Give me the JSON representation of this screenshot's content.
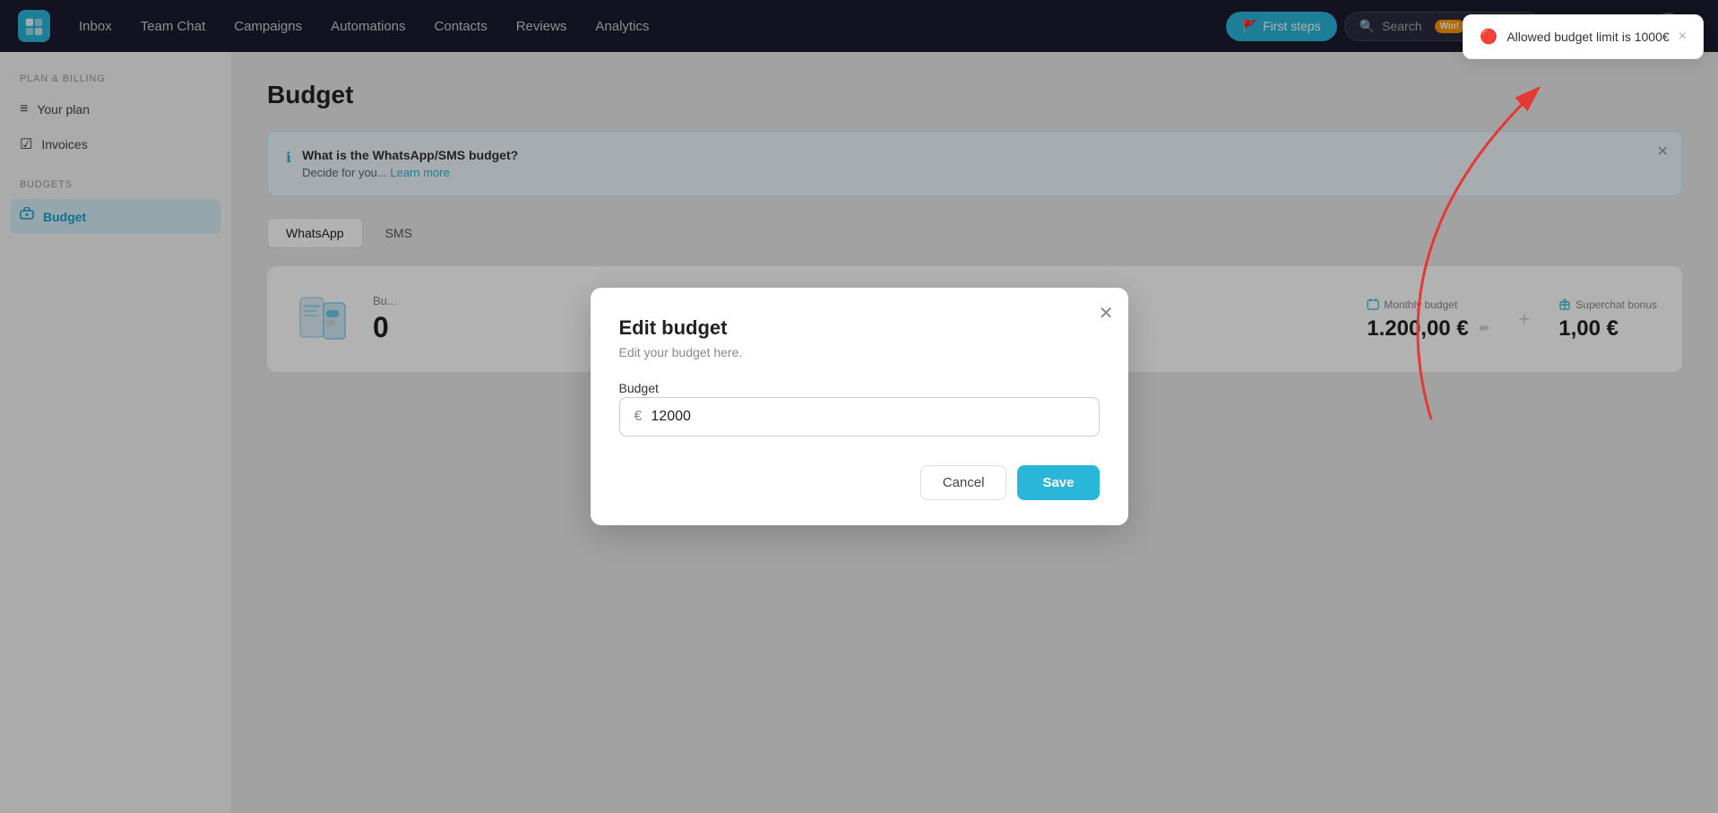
{
  "topnav": {
    "links": [
      "Inbox",
      "Team Chat",
      "Campaigns",
      "Automations",
      "Contacts",
      "Reviews",
      "Analytics"
    ],
    "first_steps_label": "First steps",
    "search_placeholder": "Search",
    "win_badge": "Win!",
    "flag_icon": "🚩"
  },
  "sidebar": {
    "plan_billing_label": "Plan & Billing",
    "items_plan": [
      {
        "label": "Your plan",
        "icon": "layers"
      },
      {
        "label": "Invoices",
        "icon": "file"
      }
    ],
    "budgets_label": "Budgets",
    "items_budgets": [
      {
        "label": "Budget",
        "icon": "budget",
        "active": true
      }
    ]
  },
  "page": {
    "title": "Budget"
  },
  "info_banner": {
    "heading": "What is the WhatsApp/SMS budget?",
    "body": "Decide for you...",
    "learn_more_label": "Learn more"
  },
  "tabs": [
    {
      "label": "WhatsApp",
      "active": true
    },
    {
      "label": "SMS",
      "active": false
    }
  ],
  "budget_card": {
    "label": "Bu...",
    "amount": "0",
    "monthly_budget_label": "Monthly budget",
    "monthly_budget_value": "1.200,00 €",
    "superchat_bonus_label": "Superchat bonus",
    "superchat_bonus_value": "1,00 €"
  },
  "modal": {
    "title": "Edit budget",
    "subtitle": "Edit your budget here.",
    "field_label": "Budget",
    "currency_symbol": "€",
    "input_value": "12000",
    "cancel_label": "Cancel",
    "save_label": "Save"
  },
  "toast": {
    "message": "Allowed budget limit is 1000€",
    "close_label": "×"
  }
}
